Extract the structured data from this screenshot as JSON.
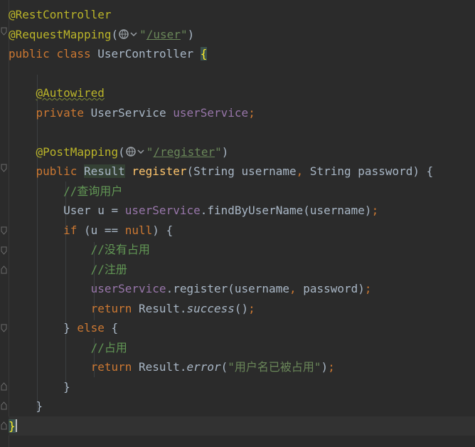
{
  "editor": {
    "code": {
      "l1": {
        "annotation": "@RestController"
      },
      "l2": {
        "annotation": "@RequestMapping",
        "open": "(",
        "q1": "\"",
        "path": "/user",
        "q2": "\"",
        "close": ")"
      },
      "l3": {
        "kw1": "public",
        "kw2": "class",
        "name": "UserController",
        "brace": "{"
      },
      "l5": {
        "annotation": "@Autowired"
      },
      "l6": {
        "kw": "private",
        "type": "UserService",
        "field": "userService",
        "semi": ";"
      },
      "l8": {
        "annotation": "@PostMapping",
        "open": "(",
        "q1": "\"",
        "path": "/register",
        "q2": "\"",
        "close": ")"
      },
      "l9": {
        "kw": "public",
        "type": "Result",
        "method": "register",
        "params": "(String username",
        "comma": ",",
        "params2": " String password) {"
      },
      "l10": {
        "comment": "//查询用户"
      },
      "l11": {
        "decl": "User u = ",
        "field": "userService",
        "call": ".findByUserName(username)",
        "semi": ";"
      },
      "l12": {
        "kw": "if",
        "cond": " (u == ",
        "null": "null",
        "rest": ") {"
      },
      "l13": {
        "comment": "//没有占用"
      },
      "l14": {
        "comment": "//注册"
      },
      "l15": {
        "field": "userService",
        "call": ".register(username",
        "comma": ",",
        "rest": " password)",
        "semi": ";"
      },
      "l16": {
        "kw": "return",
        "obj": " Result.",
        "method": "success",
        "rest": "()",
        "semi": ";"
      },
      "l17": {
        "close": "} ",
        "kw": "else",
        "open": " {"
      },
      "l18": {
        "comment": "//占用"
      },
      "l19": {
        "kw": "return",
        "obj": " Result.",
        "method": "error",
        "open": "(",
        "str": "\"用户名已被占用\"",
        "close": ")",
        "semi": ";"
      },
      "l20": {
        "brace": "}"
      },
      "l21": {
        "brace": "}"
      },
      "l22": {
        "brace": "}"
      }
    },
    "colors": {
      "background": "#2b2b2b",
      "annotation": "#bbb529",
      "keyword": "#cc7832",
      "field": "#9876aa",
      "string": "#6a8759",
      "method": "#ffc66d",
      "comment": "#629755",
      "text": "#a9b7c6"
    },
    "icons": [
      "web-endpoint-icon",
      "fold-marker-icon",
      "text-caret"
    ]
  }
}
